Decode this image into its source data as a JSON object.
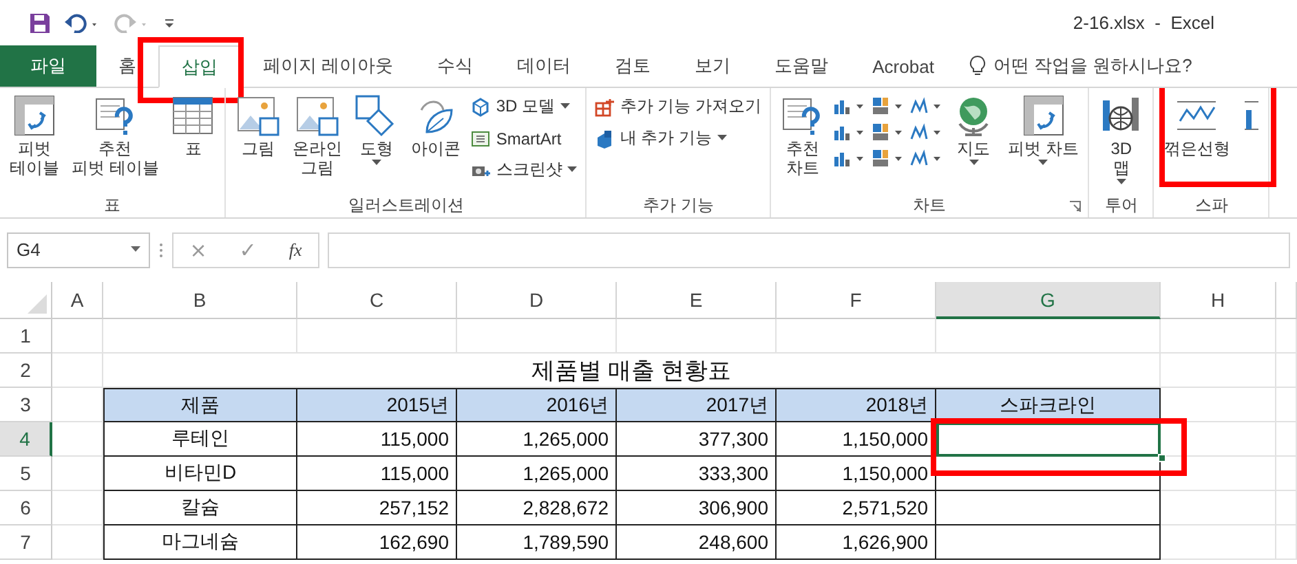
{
  "title": "2-16.xlsx  -  Excel",
  "tabs": [
    {
      "label": "파일",
      "kind": "file",
      "selected": false
    },
    {
      "label": "홈",
      "kind": "tab",
      "selected": false
    },
    {
      "label": "삽입",
      "kind": "tab",
      "selected": true,
      "highlighted": true
    },
    {
      "label": "페이지 레이아웃",
      "kind": "tab",
      "selected": false
    },
    {
      "label": "수식",
      "kind": "tab",
      "selected": false
    },
    {
      "label": "데이터",
      "kind": "tab",
      "selected": false
    },
    {
      "label": "검토",
      "kind": "tab",
      "selected": false
    },
    {
      "label": "보기",
      "kind": "tab",
      "selected": false
    },
    {
      "label": "도움말",
      "kind": "tab",
      "selected": false
    },
    {
      "label": "Acrobat",
      "kind": "tab",
      "selected": false
    }
  ],
  "tell_me": "어떤 작업을 원하시나요?",
  "ribbon_groups": [
    {
      "label": "표",
      "items": [
        {
          "kind": "pivot",
          "label": "피벗\n테이블"
        },
        {
          "kind": "recommended",
          "label": "추천\n피벗 테이블"
        },
        {
          "kind": "table",
          "label": "표"
        }
      ]
    },
    {
      "label": "일러스트레이션",
      "items": [
        {
          "kind": "picture",
          "label": "그림"
        },
        {
          "kind": "online",
          "label": "온라인\n그림"
        },
        {
          "kind": "shapes",
          "label": "도형",
          "dropdown": true
        },
        {
          "kind": "icons",
          "label": "아이콘"
        },
        {
          "kind": "stack",
          "items": [
            {
              "kind": "cube",
              "label": "3D 모델",
              "dropdown": true
            },
            {
              "kind": "smartart",
              "label": "SmartArt"
            },
            {
              "kind": "screenshot",
              "label": "스크린샷",
              "dropdown": true
            }
          ]
        }
      ]
    },
    {
      "label": "추가 기능",
      "items": [
        {
          "kind": "stack",
          "items": [
            {
              "kind": "store",
              "label": "추가 기능 가져오기"
            },
            {
              "kind": "addins",
              "label": "내 추가 기능",
              "dropdown": true
            }
          ]
        }
      ]
    },
    {
      "label": "차트",
      "launcher": true,
      "items": [
        {
          "kind": "advisor",
          "label": "추천\n차트"
        },
        {
          "kind": "gallery"
        },
        {
          "kind": "map",
          "label": "지도",
          "dropdown": true
        },
        {
          "kind": "pivotchart",
          "label": "피벗 차트",
          "dropdown": true
        }
      ]
    },
    {
      "label": "투어",
      "items": [
        {
          "kind": "globe",
          "label": "3D\n맵",
          "dropdown": true
        }
      ]
    },
    {
      "label": "스파",
      "highlighted": true,
      "items": [
        {
          "kind": "sparkline",
          "label": "꺾은선형"
        },
        {
          "kind": "columns"
        }
      ]
    }
  ],
  "name_box": "G4",
  "formula_bar": {
    "cancel": "×",
    "enter": "✓",
    "function": "fx"
  },
  "columns": [
    {
      "label": "A",
      "selected": false
    },
    {
      "label": "B",
      "selected": false
    },
    {
      "label": "C",
      "selected": false
    },
    {
      "label": "D",
      "selected": false
    },
    {
      "label": "E",
      "selected": false
    },
    {
      "label": "F",
      "selected": false
    },
    {
      "label": "G",
      "selected": true
    },
    {
      "label": "H",
      "selected": false
    }
  ],
  "rows": [
    {
      "number": "1",
      "kind": "blank",
      "selected": false
    },
    {
      "number": "2",
      "kind": "title",
      "selected": false,
      "title": "제품별 매출 현황표"
    },
    {
      "number": "3",
      "kind": "header",
      "selected": false,
      "cells": [
        "제품",
        "2015년",
        "2016년",
        "2017년",
        "2018년",
        "스파크라인"
      ]
    },
    {
      "number": "4",
      "kind": "data",
      "selected": true,
      "highlighted": true,
      "cells": [
        "루테인",
        "115,000",
        "1,265,000",
        "377,300",
        "1,150,000"
      ]
    },
    {
      "number": "5",
      "kind": "data",
      "selected": false,
      "cells": [
        "비타민D",
        "115,000",
        "1,265,000",
        "333,300",
        "1,150,000"
      ]
    },
    {
      "number": "6",
      "kind": "data",
      "selected": false,
      "cells": [
        "칼슘",
        "257,152",
        "2,828,672",
        "306,900",
        "2,571,520"
      ]
    },
    {
      "number": "7",
      "kind": "data",
      "selected": false,
      "cells": [
        "마그네슘",
        "162,690",
        "1,789,590",
        "248,600",
        "1,626,900"
      ]
    }
  ]
}
